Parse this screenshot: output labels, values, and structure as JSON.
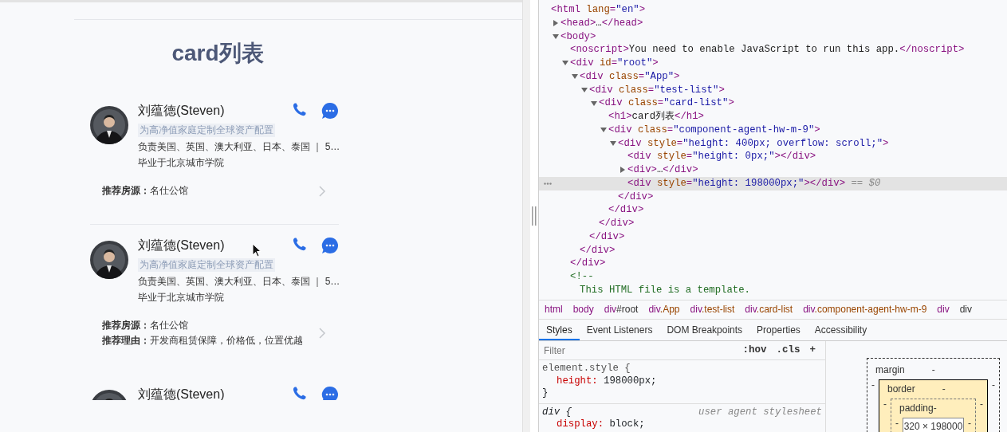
{
  "app": {
    "title": "card列表",
    "cards": [
      {
        "kind": "card",
        "name": "刘蕴德(Steven)",
        "tag": "为高净值家庭定制全球资产配置",
        "description": "负责美国、英国、澳大利亚、日本、泰国 ｜ 5…",
        "school": "毕业于北京城市学院",
        "recommendations": [
          {
            "label": "推荐房源：",
            "value": "名仕公馆"
          }
        ]
      },
      {
        "kind": "divider"
      },
      {
        "kind": "card",
        "name": "刘蕴德(Steven)",
        "tag": "为高净值家庭定制全球资产配置",
        "description": "负责美国、英国、澳大利亚、日本、泰国 ｜ 5…",
        "school": "毕业于北京城市学院",
        "recommendations": [
          {
            "label": "推荐房源：",
            "value": "名仕公馆"
          },
          {
            "label": "推荐理由：",
            "value": "开发商租赁保障，价格低，位置优越"
          }
        ]
      },
      {
        "kind": "card",
        "name": "刘蕴德(Steven)"
      }
    ]
  },
  "devtools": {
    "tree": [
      {
        "parts": [
          {
            "kind": "tag",
            "text": "<html"
          },
          {
            "kind": "attr",
            "text": " lang"
          },
          {
            "kind": "tag",
            "text": "="
          },
          {
            "kind": "value",
            "text": "\"en\""
          },
          {
            "kind": "tag",
            "text": ">"
          }
        ],
        "selected": false,
        "children": [
          {
            "parts": [
              {
                "kind": "tag",
                "text": "<head>"
              },
              {
                "kind": "text",
                "text": "…"
              },
              {
                "kind": "tag",
                "text": "</head>"
              }
            ],
            "expanded": false,
            "selected": false
          },
          {
            "parts": [
              {
                "kind": "tag",
                "text": "<body>"
              }
            ],
            "expanded": true,
            "selected": false,
            "children": [
              {
                "parts": [
                  {
                    "kind": "tag",
                    "text": "<noscript>"
                  },
                  {
                    "kind": "text",
                    "text": "You need to enable JavaScript to run this app."
                  },
                  {
                    "kind": "tag",
                    "text": "</noscript>"
                  }
                ],
                "selected": false
              },
              {
                "parts": [
                  {
                    "kind": "tag",
                    "text": "<div"
                  },
                  {
                    "kind": "attr",
                    "text": " id"
                  },
                  {
                    "kind": "tag",
                    "text": "="
                  },
                  {
                    "kind": "value",
                    "text": "\"root\""
                  },
                  {
                    "kind": "tag",
                    "text": ">"
                  }
                ],
                "expanded": true,
                "selected": false,
                "end": [
                  {
                    "kind": "tag",
                    "text": "</div>"
                  }
                ],
                "children": [
                  {
                    "parts": [
                      {
                        "kind": "tag",
                        "text": "<div"
                      },
                      {
                        "kind": "attr",
                        "text": " class"
                      },
                      {
                        "kind": "tag",
                        "text": "="
                      },
                      {
                        "kind": "value",
                        "text": "\"App\""
                      },
                      {
                        "kind": "tag",
                        "text": ">"
                      }
                    ],
                    "expanded": true,
                    "selected": false,
                    "end": [
                      {
                        "kind": "tag",
                        "text": "</div>"
                      }
                    ],
                    "children": [
                      {
                        "parts": [
                          {
                            "kind": "tag",
                            "text": "<div"
                          },
                          {
                            "kind": "attr",
                            "text": " class"
                          },
                          {
                            "kind": "tag",
                            "text": "="
                          },
                          {
                            "kind": "value",
                            "text": "\"test-list\""
                          },
                          {
                            "kind": "tag",
                            "text": ">"
                          }
                        ],
                        "expanded": true,
                        "selected": false,
                        "end": [
                          {
                            "kind": "tag",
                            "text": "</div>"
                          }
                        ],
                        "children": [
                          {
                            "parts": [
                              {
                                "kind": "tag",
                                "text": "<div"
                              },
                              {
                                "kind": "attr",
                                "text": " class"
                              },
                              {
                                "kind": "tag",
                                "text": "="
                              },
                              {
                                "kind": "value",
                                "text": "\"card-list\""
                              },
                              {
                                "kind": "tag",
                                "text": ">"
                              }
                            ],
                            "expanded": true,
                            "selected": false,
                            "end": [
                              {
                                "kind": "tag",
                                "text": "</div>"
                              }
                            ],
                            "children": [
                              {
                                "parts": [
                                  {
                                    "kind": "tag",
                                    "text": "<h1>"
                                  },
                                  {
                                    "kind": "text",
                                    "text": "card列表"
                                  },
                                  {
                                    "kind": "tag",
                                    "text": "</h1>"
                                  }
                                ],
                                "selected": false
                              },
                              {
                                "parts": [
                                  {
                                    "kind": "tag",
                                    "text": "<div"
                                  },
                                  {
                                    "kind": "attr",
                                    "text": " class"
                                  },
                                  {
                                    "kind": "tag",
                                    "text": "="
                                  },
                                  {
                                    "kind": "value",
                                    "text": "\"component-agent-hw-m-9\""
                                  },
                                  {
                                    "kind": "tag",
                                    "text": ">"
                                  }
                                ],
                                "expanded": true,
                                "selected": false,
                                "end": [
                                  {
                                    "kind": "tag",
                                    "text": "</div>"
                                  }
                                ],
                                "children": [
                                  {
                                    "parts": [
                                      {
                                        "kind": "tag",
                                        "text": "<div"
                                      },
                                      {
                                        "kind": "attr",
                                        "text": " style"
                                      },
                                      {
                                        "kind": "tag",
                                        "text": "="
                                      },
                                      {
                                        "kind": "value",
                                        "text": "\"height: 400px; overflow: scroll;\""
                                      },
                                      {
                                        "kind": "tag",
                                        "text": ">"
                                      }
                                    ],
                                    "expanded": true,
                                    "selected": false,
                                    "end": [
                                      {
                                        "kind": "tag",
                                        "text": "</div>"
                                      }
                                    ],
                                    "children": [
                                      {
                                        "parts": [
                                          {
                                            "kind": "tag",
                                            "text": "<div"
                                          },
                                          {
                                            "kind": "attr",
                                            "text": " style"
                                          },
                                          {
                                            "kind": "tag",
                                            "text": "="
                                          },
                                          {
                                            "kind": "value",
                                            "text": "\"height: 0px;\""
                                          },
                                          {
                                            "kind": "tag",
                                            "text": "></div>"
                                          }
                                        ],
                                        "selected": false
                                      },
                                      {
                                        "parts": [
                                          {
                                            "kind": "tag",
                                            "text": "<div>"
                                          },
                                          {
                                            "kind": "text",
                                            "text": "…"
                                          },
                                          {
                                            "kind": "tag",
                                            "text": "</div>"
                                          }
                                        ],
                                        "expanded": false,
                                        "selected": false
                                      },
                                      {
                                        "parts": [
                                          {
                                            "kind": "tag",
                                            "text": "<div"
                                          },
                                          {
                                            "kind": "attr",
                                            "text": " style"
                                          },
                                          {
                                            "kind": "tag",
                                            "text": "="
                                          },
                                          {
                                            "kind": "value",
                                            "text": "\"height: 198000px;\""
                                          },
                                          {
                                            "kind": "tag",
                                            "text": "></div>"
                                          },
                                          {
                                            "kind": "note",
                                            "text": " == $0"
                                          }
                                        ],
                                        "selected": true
                                      }
                                    ]
                                  }
                                ]
                              }
                            ]
                          }
                        ]
                      }
                    ]
                  }
                ]
              },
              {
                "parts": [
                  {
                    "kind": "comment",
                    "text": "<!--"
                  }
                ],
                "selected": false,
                "children": [
                  {
                    "parts": [
                      {
                        "kind": "comment",
                        "text": "This HTML file is a template."
                      }
                    ],
                    "selected": false
                  }
                ]
              }
            ]
          }
        ]
      }
    ],
    "breadcrumbs": [
      {
        "tag": "html",
        "selected": false
      },
      {
        "tag": "body",
        "selected": false
      },
      {
        "tag": "div",
        "suffix": "#root",
        "selected": false
      },
      {
        "tag": "div",
        "suffix": ".App",
        "selected": false
      },
      {
        "tag": "div",
        "suffix": ".test-list",
        "selected": false
      },
      {
        "tag": "div",
        "suffix": ".card-list",
        "selected": false
      },
      {
        "tag": "div",
        "suffix": ".component-agent-hw-m-9",
        "selected": false
      },
      {
        "tag": "div",
        "selected": false
      },
      {
        "tag": "div",
        "selected": true
      }
    ],
    "tabs": [
      {
        "label": "Styles",
        "selected": true
      },
      {
        "label": "Event Listeners",
        "selected": false
      },
      {
        "label": "DOM Breakpoints",
        "selected": false
      },
      {
        "label": "Properties",
        "selected": false
      },
      {
        "label": "Accessibility",
        "selected": false
      }
    ],
    "filter": {
      "placeholder": "Filter",
      "buttons": [
        ":hov",
        ".cls",
        "+"
      ]
    },
    "rules": [
      {
        "selector": "element.style {",
        "italic": false,
        "declarations": [
          {
            "property": "height:",
            "value": "198000px;"
          }
        ],
        "close": "}"
      },
      {
        "selector": "div {",
        "origin": "user agent stylesheet",
        "italic": true,
        "declarations": [
          {
            "property": "display:",
            "value": "block;"
          }
        ]
      }
    ],
    "box_model": {
      "margin_label": "margin",
      "margin_top": "-",
      "border_label": "border",
      "border_top": "-",
      "padding_label": "padding",
      "padding_top": "-",
      "content": "320 × 198000",
      "margin_left": "-",
      "border_left": "-",
      "padding_left": "-",
      "padding_right": "-",
      "border_right": "-",
      "margin_right": "-"
    }
  }
}
